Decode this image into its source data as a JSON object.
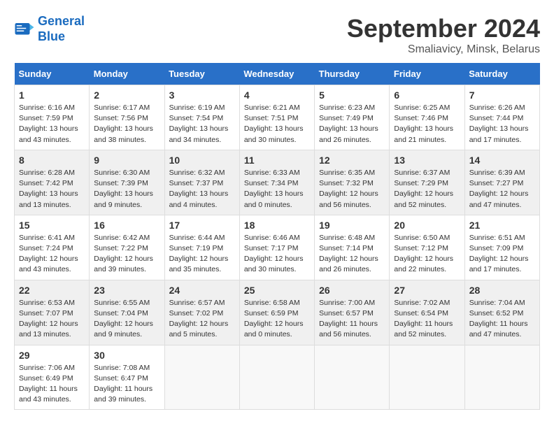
{
  "logo": {
    "line1": "General",
    "line2": "Blue"
  },
  "header": {
    "month": "September 2024",
    "location": "Smaliavicy, Minsk, Belarus"
  },
  "weekdays": [
    "Sunday",
    "Monday",
    "Tuesday",
    "Wednesday",
    "Thursday",
    "Friday",
    "Saturday"
  ],
  "weeks": [
    [
      {
        "day": "1",
        "info": "Sunrise: 6:16 AM\nSunset: 7:59 PM\nDaylight: 13 hours\nand 43 minutes."
      },
      {
        "day": "2",
        "info": "Sunrise: 6:17 AM\nSunset: 7:56 PM\nDaylight: 13 hours\nand 38 minutes."
      },
      {
        "day": "3",
        "info": "Sunrise: 6:19 AM\nSunset: 7:54 PM\nDaylight: 13 hours\nand 34 minutes."
      },
      {
        "day": "4",
        "info": "Sunrise: 6:21 AM\nSunset: 7:51 PM\nDaylight: 13 hours\nand 30 minutes."
      },
      {
        "day": "5",
        "info": "Sunrise: 6:23 AM\nSunset: 7:49 PM\nDaylight: 13 hours\nand 26 minutes."
      },
      {
        "day": "6",
        "info": "Sunrise: 6:25 AM\nSunset: 7:46 PM\nDaylight: 13 hours\nand 21 minutes."
      },
      {
        "day": "7",
        "info": "Sunrise: 6:26 AM\nSunset: 7:44 PM\nDaylight: 13 hours\nand 17 minutes."
      }
    ],
    [
      {
        "day": "8",
        "info": "Sunrise: 6:28 AM\nSunset: 7:42 PM\nDaylight: 13 hours\nand 13 minutes."
      },
      {
        "day": "9",
        "info": "Sunrise: 6:30 AM\nSunset: 7:39 PM\nDaylight: 13 hours\nand 9 minutes."
      },
      {
        "day": "10",
        "info": "Sunrise: 6:32 AM\nSunset: 7:37 PM\nDaylight: 13 hours\nand 4 minutes."
      },
      {
        "day": "11",
        "info": "Sunrise: 6:33 AM\nSunset: 7:34 PM\nDaylight: 13 hours\nand 0 minutes."
      },
      {
        "day": "12",
        "info": "Sunrise: 6:35 AM\nSunset: 7:32 PM\nDaylight: 12 hours\nand 56 minutes."
      },
      {
        "day": "13",
        "info": "Sunrise: 6:37 AM\nSunset: 7:29 PM\nDaylight: 12 hours\nand 52 minutes."
      },
      {
        "day": "14",
        "info": "Sunrise: 6:39 AM\nSunset: 7:27 PM\nDaylight: 12 hours\nand 47 minutes."
      }
    ],
    [
      {
        "day": "15",
        "info": "Sunrise: 6:41 AM\nSunset: 7:24 PM\nDaylight: 12 hours\nand 43 minutes."
      },
      {
        "day": "16",
        "info": "Sunrise: 6:42 AM\nSunset: 7:22 PM\nDaylight: 12 hours\nand 39 minutes."
      },
      {
        "day": "17",
        "info": "Sunrise: 6:44 AM\nSunset: 7:19 PM\nDaylight: 12 hours\nand 35 minutes."
      },
      {
        "day": "18",
        "info": "Sunrise: 6:46 AM\nSunset: 7:17 PM\nDaylight: 12 hours\nand 30 minutes."
      },
      {
        "day": "19",
        "info": "Sunrise: 6:48 AM\nSunset: 7:14 PM\nDaylight: 12 hours\nand 26 minutes."
      },
      {
        "day": "20",
        "info": "Sunrise: 6:50 AM\nSunset: 7:12 PM\nDaylight: 12 hours\nand 22 minutes."
      },
      {
        "day": "21",
        "info": "Sunrise: 6:51 AM\nSunset: 7:09 PM\nDaylight: 12 hours\nand 17 minutes."
      }
    ],
    [
      {
        "day": "22",
        "info": "Sunrise: 6:53 AM\nSunset: 7:07 PM\nDaylight: 12 hours\nand 13 minutes."
      },
      {
        "day": "23",
        "info": "Sunrise: 6:55 AM\nSunset: 7:04 PM\nDaylight: 12 hours\nand 9 minutes."
      },
      {
        "day": "24",
        "info": "Sunrise: 6:57 AM\nSunset: 7:02 PM\nDaylight: 12 hours\nand 5 minutes."
      },
      {
        "day": "25",
        "info": "Sunrise: 6:58 AM\nSunset: 6:59 PM\nDaylight: 12 hours\nand 0 minutes."
      },
      {
        "day": "26",
        "info": "Sunrise: 7:00 AM\nSunset: 6:57 PM\nDaylight: 11 hours\nand 56 minutes."
      },
      {
        "day": "27",
        "info": "Sunrise: 7:02 AM\nSunset: 6:54 PM\nDaylight: 11 hours\nand 52 minutes."
      },
      {
        "day": "28",
        "info": "Sunrise: 7:04 AM\nSunset: 6:52 PM\nDaylight: 11 hours\nand 47 minutes."
      }
    ],
    [
      {
        "day": "29",
        "info": "Sunrise: 7:06 AM\nSunset: 6:49 PM\nDaylight: 11 hours\nand 43 minutes."
      },
      {
        "day": "30",
        "info": "Sunrise: 7:08 AM\nSunset: 6:47 PM\nDaylight: 11 hours\nand 39 minutes."
      },
      {
        "day": "",
        "info": ""
      },
      {
        "day": "",
        "info": ""
      },
      {
        "day": "",
        "info": ""
      },
      {
        "day": "",
        "info": ""
      },
      {
        "day": "",
        "info": ""
      }
    ]
  ]
}
